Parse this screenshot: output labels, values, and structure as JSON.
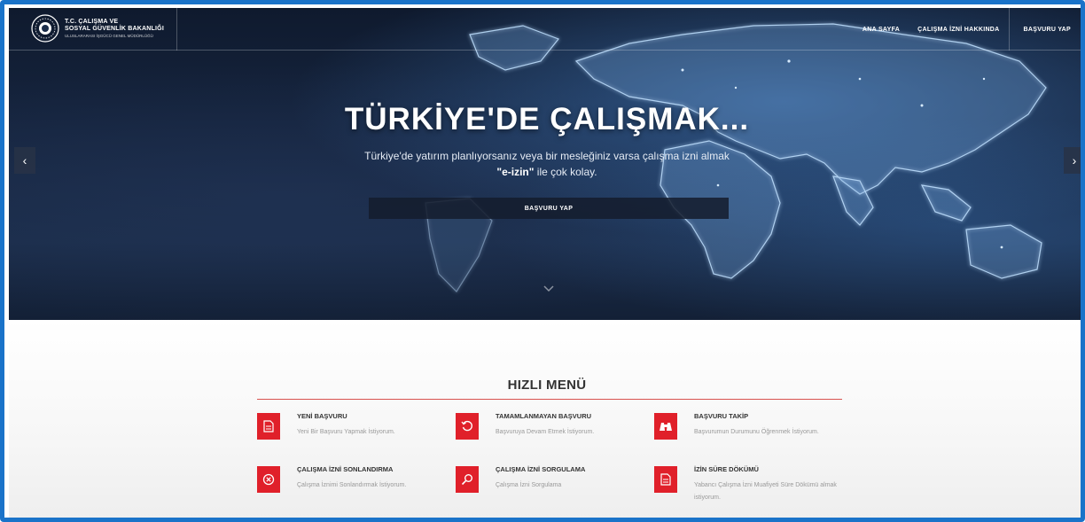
{
  "header": {
    "logo_line1": "T.C. ÇALIŞMA VE",
    "logo_line2": "SOSYAL GÜVENLİK BAKANLIĞI",
    "logo_line3": "ULUSLARARASI İŞGÜCÜ GENEL MÜDÜRLÜĞÜ",
    "nav": [
      {
        "label": "ANA SAYFA"
      },
      {
        "label": "ÇALIŞMA İZNİ HAKKINDA"
      },
      {
        "label": "BAŞVURU YAP"
      }
    ]
  },
  "hero": {
    "title": "TÜRKİYE'DE ÇALIŞMAK...",
    "subtitle_line1": "Türkiye'de yatırım planlıyorsanız veya bir mesleğiniz varsa çalışma izni almak",
    "subtitle_bold": "\"e-izin\"",
    "subtitle_rest": " ile çok kolay.",
    "button_label": "BAŞVURU YAP",
    "prev_icon": "chevron-left-icon",
    "next_icon": "chevron-right-icon",
    "scroll_icon": "chevron-down-icon"
  },
  "quick_menu": {
    "title": "HIZLI MENÜ",
    "accent_color": "#e0202a",
    "items": [
      {
        "label": "YENİ BAŞVURU",
        "desc": "Yeni Bir Başvuru Yapmak İstiyorum.",
        "icon": "document-icon"
      },
      {
        "label": "TAMAMLANMAYAN BAŞVURU",
        "desc": "Başvuruya Devam Etmek İstiyorum.",
        "icon": "refresh-icon"
      },
      {
        "label": "BAŞVURU TAKİP",
        "desc": "Başvurumun Durumunu Öğrenmek İstiyorum.",
        "icon": "binoculars-icon"
      },
      {
        "label": "ÇALIŞMA İZNİ SONLANDIRMA",
        "desc": "Çalışma İznimi Sonlandırmak İstiyorum.",
        "icon": "cancel-circle-icon"
      },
      {
        "label": "ÇALIŞMA İZNİ SORGULAMA",
        "desc": "Çalışma İzni Sorgulama",
        "icon": "search-icon"
      },
      {
        "label": "İZİN SÜRE DÖKÜMÜ",
        "desc": "Yabancı Çalışma İzni Muafiyeti Süre Dökümü almak istiyorum.",
        "icon": "document-icon"
      }
    ]
  }
}
